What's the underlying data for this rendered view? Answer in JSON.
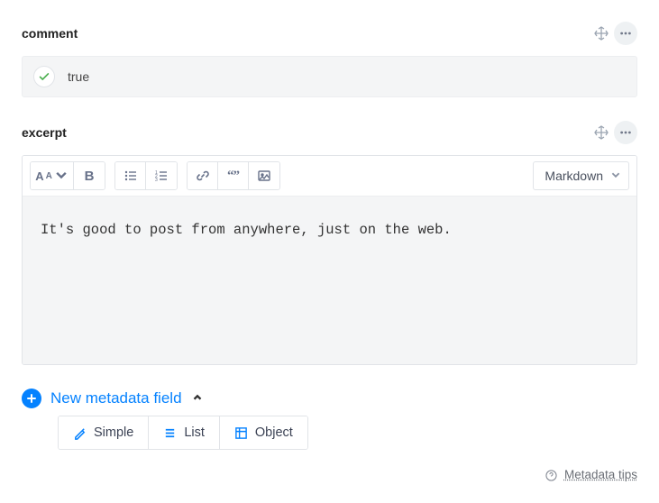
{
  "sections": {
    "comment": {
      "title": "comment",
      "bool_value": "true"
    },
    "excerpt": {
      "title": "excerpt",
      "format": "Markdown",
      "content": "It's good to post from anywhere, just on the web."
    }
  },
  "new_field": {
    "label": "New metadata field",
    "tabs": {
      "simple": "Simple",
      "list": "List",
      "object": "Object"
    }
  },
  "footer": {
    "tip": "Metadata tips"
  }
}
